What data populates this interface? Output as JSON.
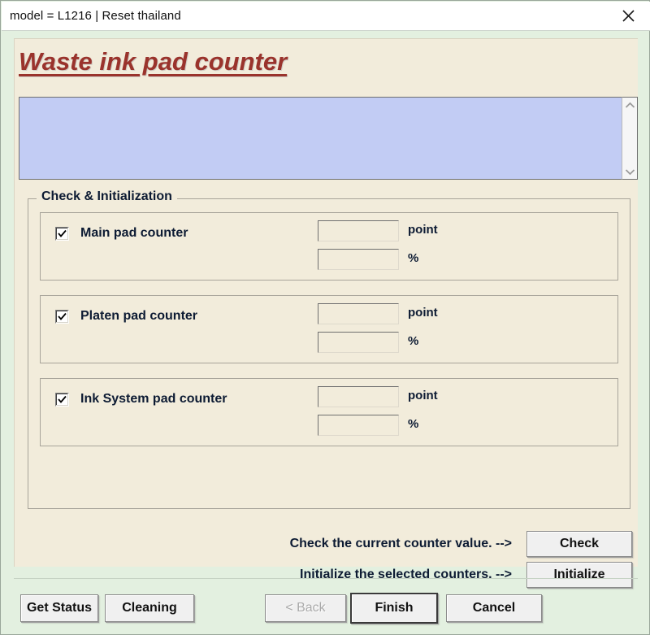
{
  "window": {
    "title": "model = L1216 | Reset thailand",
    "close_icon": "close-icon",
    "page_title": "Waste ink pad counter",
    "accent_color": "#9a332c",
    "panel_color": "#f2ecdb",
    "window_color": "#e3f0e0",
    "log_color": "#c2ccf4"
  },
  "log": {
    "value": "",
    "placeholder": "",
    "scroll_up": "⌃",
    "scroll_down": "⌄"
  },
  "group": {
    "legend": "Check & Initialization",
    "counters": [
      {
        "label": "Main pad counter",
        "checked": true,
        "point_value": "",
        "point_unit": "point",
        "percent_value": "",
        "percent_unit": "%"
      },
      {
        "label": "Platen pad counter",
        "checked": true,
        "point_value": "",
        "point_unit": "point",
        "percent_value": "",
        "percent_unit": "%"
      },
      {
        "label": "Ink System pad counter",
        "checked": true,
        "point_value": "",
        "point_unit": "point",
        "percent_value": "",
        "percent_unit": "%"
      }
    ]
  },
  "actions": [
    {
      "text": "Check the current counter value. -->",
      "button": "Check"
    },
    {
      "text": "Initialize the selected counters. -->",
      "button": "Initialize"
    }
  ],
  "footer": {
    "get_status": "Get Status",
    "cleaning": "Cleaning",
    "back": "< Back",
    "finish": "Finish",
    "cancel": "Cancel"
  }
}
